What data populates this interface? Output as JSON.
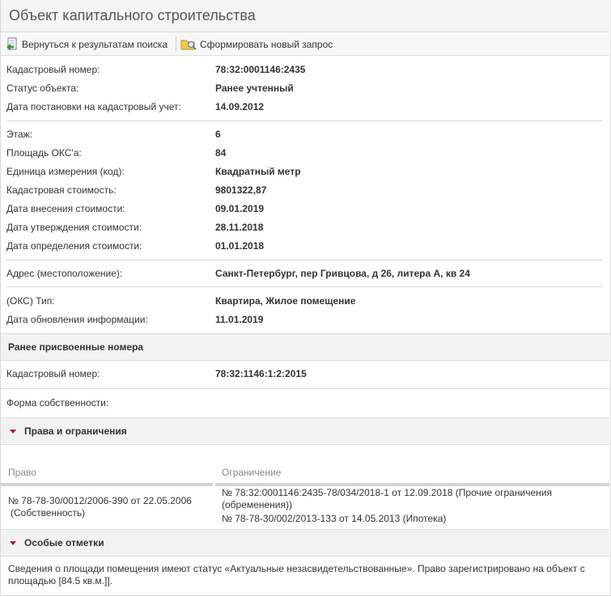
{
  "title": "Объект капитального строительства",
  "toolbar": {
    "back_label": "Вернуться к результатам поиска",
    "new_query_label": "Сформировать новый запрос"
  },
  "fields": {
    "cadastral_number": {
      "label": "Кадастровый номер:",
      "value": "78:32:0001146:2435"
    },
    "status": {
      "label": "Статус объекта:",
      "value": "Ранее учтенный"
    },
    "registration_date": {
      "label": "Дата постановки на кадастровый учет:",
      "value": "14.09.2012"
    },
    "floor": {
      "label": "Этаж:",
      "value": "6"
    },
    "area": {
      "label": "Площадь ОКС'а:",
      "value": "84"
    },
    "unit": {
      "label": "Единица измерения (код):",
      "value": "Квадратный метр"
    },
    "cadastral_value": {
      "label": "Кадастровая стоимость:",
      "value": "9801322,87"
    },
    "value_entry_date": {
      "label": "Дата внесения стоимости:",
      "value": "09.01.2019"
    },
    "value_approval_date": {
      "label": "Дата утверждения стоимости:",
      "value": "28.11.2018"
    },
    "value_determination_date": {
      "label": "Дата определения стоимости:",
      "value": "01.01.2018"
    },
    "address": {
      "label": "Адрес (местоположение):",
      "value": "Санкт-Петербург, пер Гривцова, д 26, литера А, кв 24"
    },
    "oks_type": {
      "label": "(ОКС) Тип:",
      "value": "Квартира, Жилое помещение"
    },
    "info_update_date": {
      "label": "Дата обновления информации:",
      "value": "11.01.2019"
    }
  },
  "previous_numbers": {
    "title": "Ранее присвоенные номера",
    "label": "Кадастровый номер:",
    "value": "78:32:1146:1:2:2015"
  },
  "ownership": {
    "label": "Форма собственности:",
    "value": ""
  },
  "rights": {
    "title": "Права и ограничения",
    "col_right": "Право",
    "col_restriction": "Ограничение",
    "right_line1": "№ 78-78-30/0012/2006-390  от 22.05.2006",
    "right_line2": "(Собственность)",
    "restriction1_line1": "№ 78:32:0001146:2435-78/034/2018-1  от 12.09.2018  (Прочие ограничения",
    "restriction1_line2": "(обременения))",
    "restriction2": "№ 78-78-30/002/2013-133  от 14.05.2013  (Ипотека)"
  },
  "special_notes": {
    "title": "Особые отметки",
    "text": "Сведения о площади помещения имеют статус «Актуальные незасвидетельствованные». Право зарегистрировано на объект с площадью [84.5 кв.м.]]."
  },
  "colors": {
    "accent_triangle": "#b0183a",
    "section_bg": "#f2f2f2"
  },
  "icons": {
    "back": "back-arrow-document-icon",
    "new_query": "folder-new-query-icon"
  }
}
